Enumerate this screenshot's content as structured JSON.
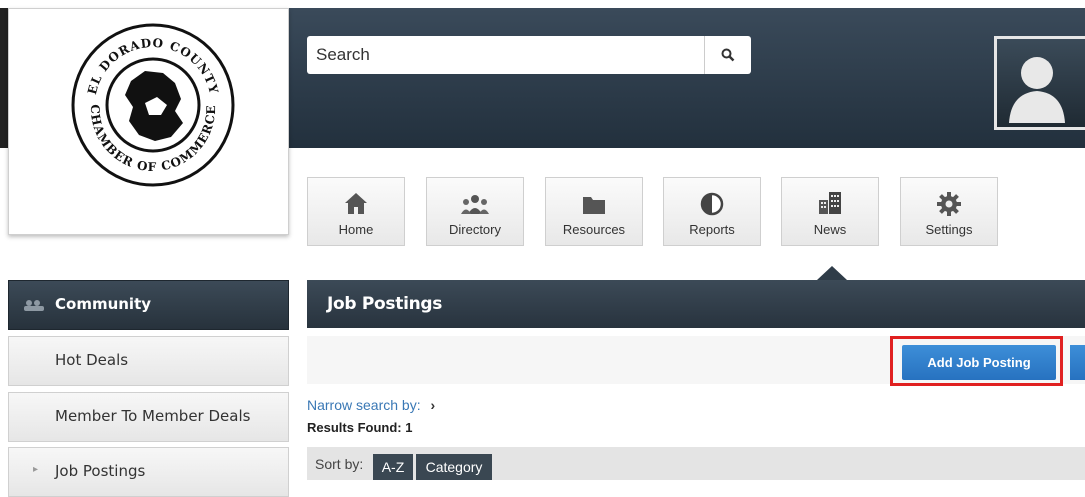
{
  "header": {
    "search_placeholder": "Search",
    "logo": {
      "org_name_top": "EL DORADO COUNTY",
      "org_name_bottom": "CHAMBER OF COMMERCE"
    }
  },
  "nav": [
    {
      "label": "Home",
      "icon": "home-icon"
    },
    {
      "label": "Directory",
      "icon": "people-icon"
    },
    {
      "label": "Resources",
      "icon": "folder-icon"
    },
    {
      "label": "Reports",
      "icon": "pie-chart-icon"
    },
    {
      "label": "News",
      "icon": "buildings-icon"
    },
    {
      "label": "Settings",
      "icon": "gear-icon"
    }
  ],
  "sidebar": {
    "items": [
      {
        "label": "Community"
      },
      {
        "label": "Hot Deals"
      },
      {
        "label": "Member To Member Deals"
      },
      {
        "label": "Job Postings"
      }
    ]
  },
  "main": {
    "title": "Job Postings",
    "add_button": "Add Job Posting",
    "narrow_label": "Narrow search by:",
    "results": "Results Found: 1",
    "sort_label": "Sort by:",
    "sort_options": [
      "A-Z",
      "Category"
    ]
  },
  "colors": {
    "header_dark": "#2b3946",
    "accent_blue": "#2f7fcf",
    "highlight_red": "#e02020"
  }
}
